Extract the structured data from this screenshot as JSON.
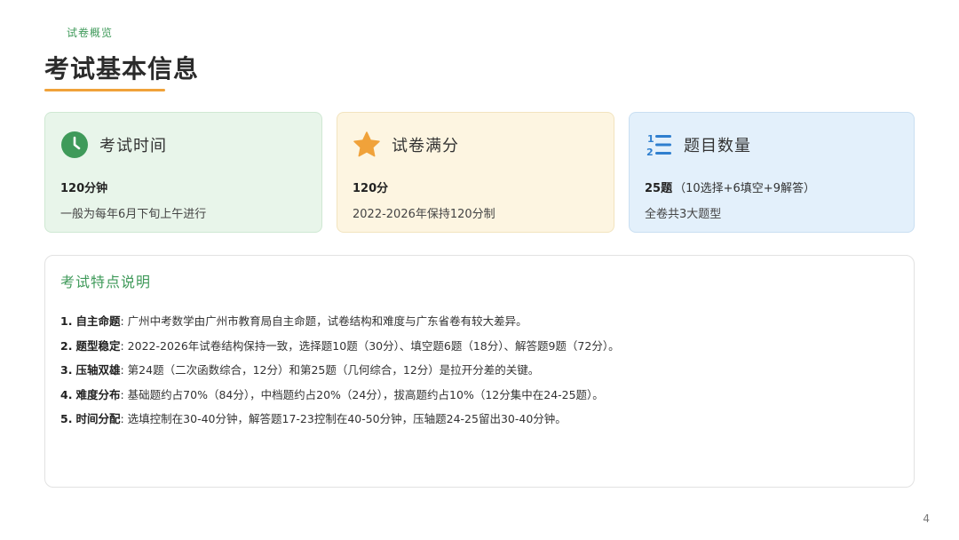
{
  "header": {
    "breadcrumb": "试卷概览",
    "title": "考试基本信息"
  },
  "cards": [
    {
      "icon": "clock-icon",
      "title": "考试时间",
      "value": "120分钟",
      "value_sub": "",
      "desc": "一般为每年6月下旬上午进行",
      "accent": "#3f9a5a"
    },
    {
      "icon": "star-icon",
      "title": "试卷满分",
      "value": "120分",
      "value_sub": "",
      "desc": "2022-2026年保持120分制",
      "accent": "#f0a23a"
    },
    {
      "icon": "numbered-list-icon",
      "title": "题目数量",
      "value": "25题",
      "value_sub": "（10选择+6填空+9解答）",
      "desc": "全卷共3大题型",
      "accent": "#2f7fcf"
    }
  ],
  "features": {
    "title": "考试特点说明",
    "items": [
      {
        "num": "1.",
        "label": "自主命题",
        "text": "广州中考数学由广州市教育局自主命题，试卷结构和难度与广东省卷有较大差异。"
      },
      {
        "num": "2.",
        "label": "题型稳定",
        "text": "2022-2026年试卷结构保持一致，选择题10题（30分）、填空题6题（18分）、解答题9题（72分）。"
      },
      {
        "num": "3.",
        "label": "压轴双雄",
        "text": "第24题（二次函数综合，12分）和第25题（几何综合，12分）是拉开分差的关键。"
      },
      {
        "num": "4.",
        "label": "难度分布",
        "text": "基础题约占70%（84分），中档题约占20%（24分），拔高题约占10%（12分集中在24-25题）。"
      },
      {
        "num": "5.",
        "label": "时间分配",
        "text": "选填控制在30-40分钟，解答题17-23控制在40-50分钟，压轴题24-25留出30-40分钟。"
      }
    ]
  },
  "footer": {
    "page_number": "4"
  }
}
